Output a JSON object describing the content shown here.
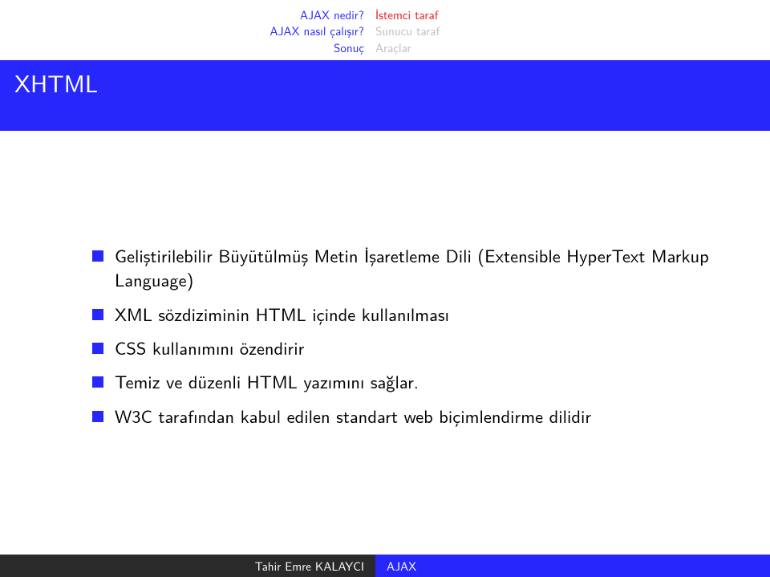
{
  "nav": {
    "left": [
      "AJAX nedir?",
      "AJAX nasıl çalışır?",
      "Sonuç"
    ],
    "right": [
      {
        "label": "İstemci taraf",
        "active": true
      },
      {
        "label": "Sunucu taraf",
        "active": false
      },
      {
        "label": "Araçlar",
        "active": false
      }
    ]
  },
  "title": "XHTML",
  "bullets": [
    "Geliştirilebilir Büyütülmüş Metin İşaretleme Dili (Extensible HyperText Markup Language)",
    "XML sözdiziminin HTML içinde kullanılması",
    "CSS kullanımını özendirir",
    "Temiz ve düzenli HTML yazımını sağlar.",
    "W3C tarafından kabul edilen standart web biçimlendirme dilidir"
  ],
  "footer": {
    "author": "Tahir Emre KALAYCI",
    "short": "AJAX"
  }
}
